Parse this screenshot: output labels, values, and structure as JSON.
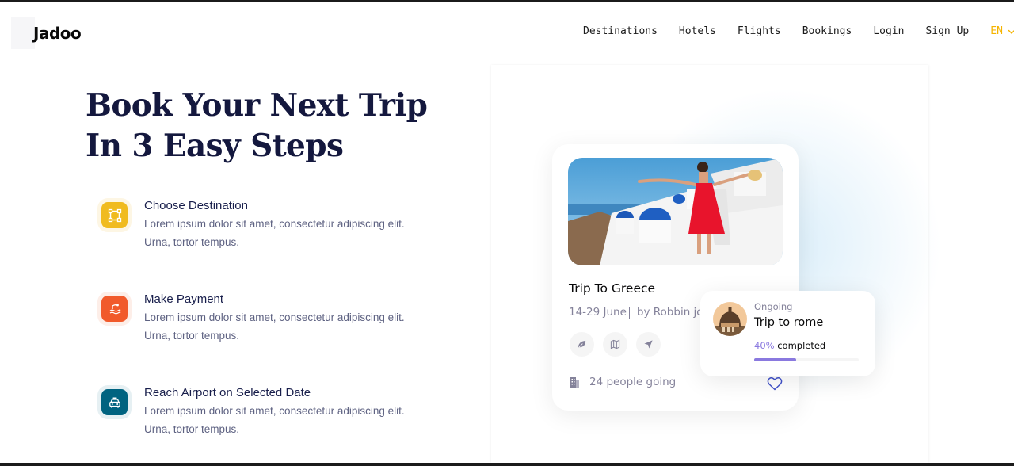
{
  "header": {
    "logo": "Jadoo",
    "nav": [
      "Destinations",
      "Hotels",
      "Flights",
      "Bookings",
      "Login",
      "Sign Up"
    ],
    "language": "EN"
  },
  "hero": {
    "headline_line1": "Book Your Next Trip",
    "headline_line2": "In 3 Easy Steps"
  },
  "steps": [
    {
      "title": "Choose Destination",
      "desc_line1": "Lorem ipsum dolor sit amet, consectetur adipiscing elit.",
      "desc_line2": "Urna, tortor tempus.",
      "icon": "selection-icon",
      "color": "#F0BB1F"
    },
    {
      "title": "Make Payment",
      "desc_line1": "Lorem ipsum dolor sit amet, consectetur adipiscing elit.",
      "desc_line2": "Urna, tortor tempus.",
      "icon": "water-sport-icon",
      "color": "#F15A2B"
    },
    {
      "title": "Reach Airport on Selected Date",
      "desc_line1": "Lorem ipsum dolor sit amet, consectetur adipiscing elit.",
      "desc_line2": "Urna, tortor tempus.",
      "icon": "taxi-icon",
      "color": "#006380"
    }
  ],
  "trip_card": {
    "title": "Trip To Greece",
    "dates": "14-29 June",
    "author": "by Robbin jo",
    "actions": [
      "leaf-icon",
      "map-icon",
      "send-icon"
    ],
    "people_going": "24 people going"
  },
  "ongoing_card": {
    "label": "Ongoing",
    "title": "Trip to rome",
    "progress_pct_text": "40%",
    "progress_suffix": " completed",
    "progress_value": 0.4
  },
  "colors": {
    "accent": "#F5B400",
    "heading": "#14183E",
    "body": "#5E6282",
    "progress": "#8A79DF"
  }
}
